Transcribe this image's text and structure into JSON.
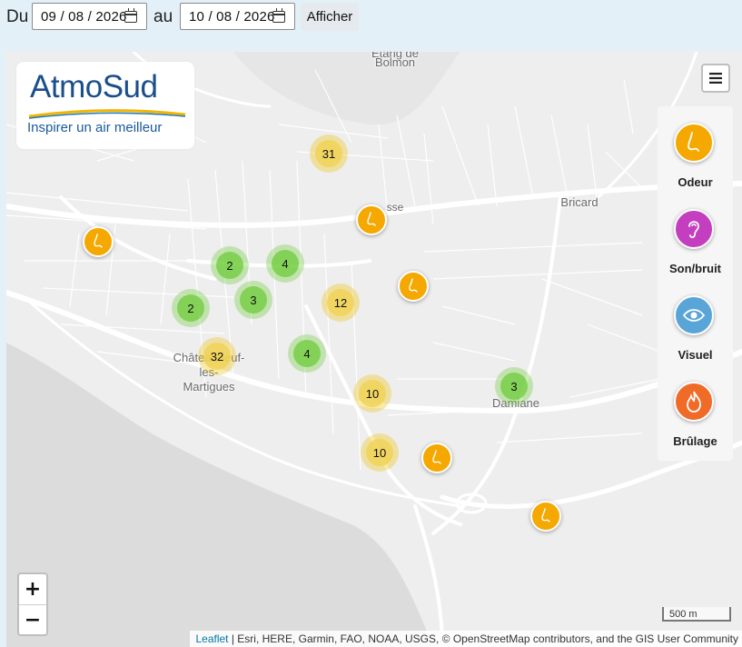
{
  "toolbar": {
    "from_label": "Du",
    "from_date": "09 / 08 / 2026",
    "to_label": "au",
    "to_date": "10 / 08 / 2026",
    "submit_label": "Afficher"
  },
  "logo": {
    "brand": "AtmoSud",
    "slogan": "Inspirer un air meilleur"
  },
  "map": {
    "places": [
      {
        "id": "etang",
        "text": "Etang de"
      },
      {
        "id": "bolmon",
        "text": "Bolmon"
      },
      {
        "id": "bricard",
        "text": "Bricard"
      },
      {
        "id": "chateauneuf",
        "text": "Châteauneuf-\nles-\nMartigues"
      },
      {
        "id": "damiane",
        "text": "Damiane"
      },
      {
        "id": "road_sse",
        "text": "sse"
      }
    ],
    "clusters": [
      {
        "count": "31",
        "level": "yellow"
      },
      {
        "count": "2",
        "level": "green"
      },
      {
        "count": "4",
        "level": "green"
      },
      {
        "count": "2",
        "level": "green"
      },
      {
        "count": "3",
        "level": "green"
      },
      {
        "count": "12",
        "level": "yellow"
      },
      {
        "count": "32",
        "level": "yellow"
      },
      {
        "count": "4",
        "level": "green"
      },
      {
        "count": "10",
        "level": "yellow"
      },
      {
        "count": "3",
        "level": "green"
      },
      {
        "count": "10",
        "level": "yellow"
      }
    ],
    "markers": [
      {
        "type": "odeur"
      },
      {
        "type": "odeur"
      },
      {
        "type": "odeur"
      },
      {
        "type": "odeur"
      },
      {
        "type": "odeur"
      }
    ],
    "zoom_in": "+",
    "zoom_out": "−",
    "scale": "500 m",
    "attribution_link": "Leaflet",
    "attribution_text": " | Esri, HERE, Garmin, FAO, NOAA, USGS, © OpenStreetMap contributors, and the GIS User Community"
  },
  "legend": {
    "items": [
      {
        "label": "Odeur",
        "color": "#f5a800",
        "icon": "nose-icon"
      },
      {
        "label": "Son/bruit",
        "color": "#c43fc0",
        "icon": "ear-icon"
      },
      {
        "label": "Visuel",
        "color": "#5aa5d8",
        "icon": "eye-icon"
      },
      {
        "label": "Brûlage",
        "color": "#f06a28",
        "icon": "fire-icon"
      }
    ]
  },
  "colors": {
    "cluster_green": "#6ecc39",
    "cluster_yellow": "#f1d357",
    "marker_odeur": "#f5a800",
    "brand_blue": "#1a4f8c"
  }
}
